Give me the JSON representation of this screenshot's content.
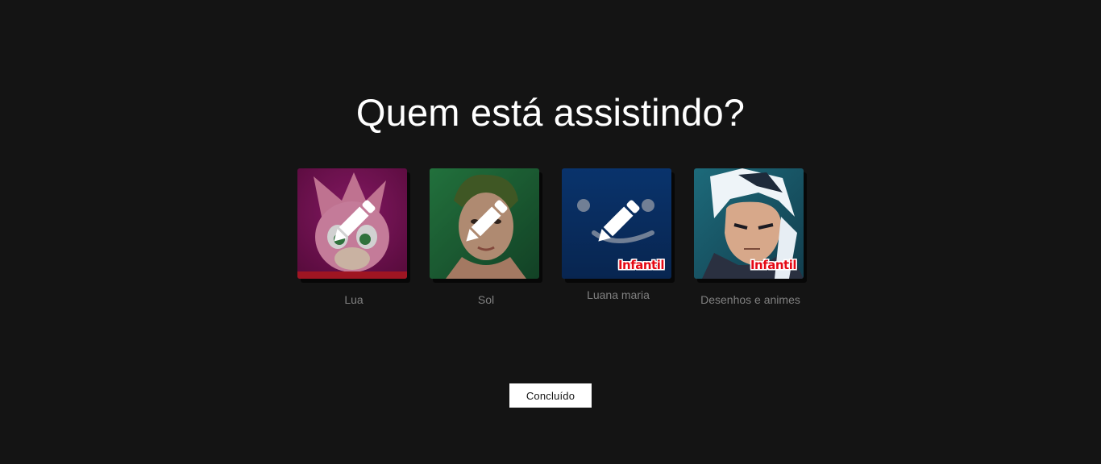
{
  "title": "Quem está assistindo?",
  "profiles": [
    {
      "name": "Lua",
      "kids_badge": "",
      "avatar": "pink-hedgehog-character-avatar",
      "bg_color": "#8a1560"
    },
    {
      "name": "Sol",
      "kids_badge": "",
      "avatar": "person-portrait-avatar",
      "bg_color": "#1f6b3a"
    },
    {
      "name": "Luana maria",
      "kids_badge": "Infantil",
      "avatar": "smiley-face-avatar",
      "bg_color": "#0a3a7a"
    },
    {
      "name": "Desenhos e animes",
      "kids_badge": "Infantil",
      "avatar": "anime-character-avatar",
      "bg_color": "#1b5e6e"
    }
  ],
  "done_button": {
    "label": "Concluído"
  },
  "colors": {
    "background": "#141414",
    "kids_badge": "#e50914",
    "name_text": "#808080"
  }
}
